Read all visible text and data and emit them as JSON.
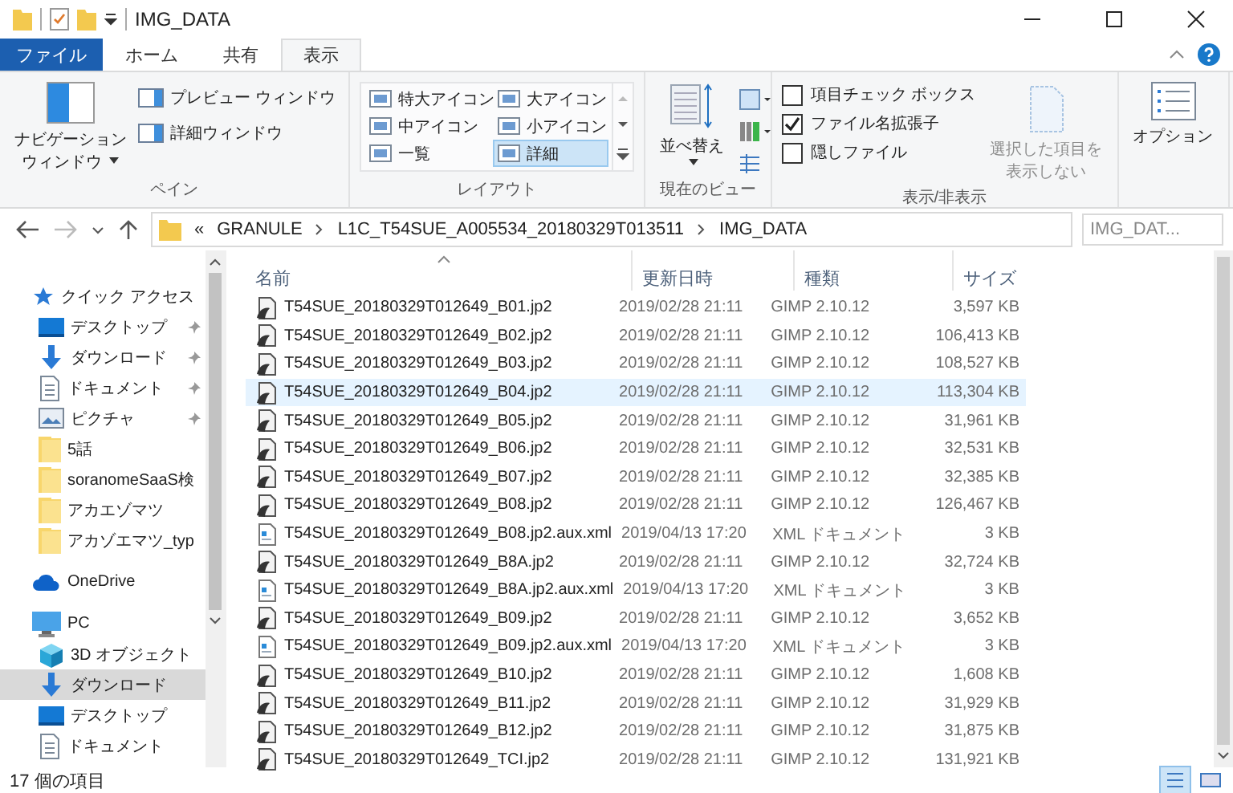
{
  "title_bar": {
    "title": "IMG_DATA"
  },
  "ribbon_tabs": [
    {
      "label": "ファイル",
      "kind": "file",
      "selected": false
    },
    {
      "label": "ホーム",
      "kind": "tab",
      "selected": false
    },
    {
      "label": "共有",
      "kind": "tab",
      "selected": false
    },
    {
      "label": "表示",
      "kind": "tab",
      "selected": true
    }
  ],
  "panes": {
    "caption": "ペイン",
    "nav_pane": [
      "ナビゲーション",
      "ウィンドウ"
    ],
    "preview_pane": "プレビュー ウィンドウ",
    "details_pane": "詳細ウィンドウ"
  },
  "layout": {
    "caption": "レイアウト",
    "options": [
      {
        "label": "特大アイコン",
        "selected": false
      },
      {
        "label": "大アイコン",
        "selected": false
      },
      {
        "label": "中アイコン",
        "selected": false
      },
      {
        "label": "小アイコン",
        "selected": false
      },
      {
        "label": "一覧",
        "selected": false
      },
      {
        "label": "詳細",
        "selected": true
      }
    ]
  },
  "current_view": {
    "caption": "現在のビュー",
    "sort_label": "並べ替え"
  },
  "show_hide": {
    "caption": "表示/非表示",
    "checkboxes": [
      {
        "label": "項目チェック ボックス",
        "checked": false
      },
      {
        "label": "ファイル名拡張子",
        "checked": true
      },
      {
        "label": "隠しファイル",
        "checked": false
      }
    ],
    "hide_selected": {
      "lines": [
        "選択した項目を",
        "表示しない"
      ],
      "disabled": true
    }
  },
  "options": {
    "label": "オプション"
  },
  "nav_buttons": [
    {
      "kind": "back",
      "disabled": false
    },
    {
      "kind": "forward",
      "disabled": true
    },
    {
      "kind": "recent",
      "disabled": false
    },
    {
      "kind": "up",
      "disabled": false
    }
  ],
  "breadcrumb": {
    "overflow": "«",
    "parts": [
      "GRANULE",
      "L1C_T54SUE_A005534_20180329T013511",
      "IMG_DATA"
    ]
  },
  "search": {
    "placeholder": "IMG_DAT..."
  },
  "sidebar": [
    {
      "label": "クイック アクセス",
      "kind": "star",
      "selected": false,
      "children": [
        {
          "label": "デスクトップ",
          "kind": "desktop",
          "pinned": true,
          "selected": false
        },
        {
          "label": "ダウンロード",
          "kind": "download",
          "pinned": true,
          "selected": false
        },
        {
          "label": "ドキュメント",
          "kind": "documents",
          "pinned": true,
          "selected": false
        },
        {
          "label": "ピクチャ",
          "kind": "pictures",
          "pinned": true,
          "selected": false
        },
        {
          "label": "5話",
          "kind": "folder",
          "pinned": false,
          "selected": false
        },
        {
          "label": "soranomeSaaS検",
          "kind": "folder",
          "pinned": false,
          "selected": false
        },
        {
          "label": "アカエゾマツ",
          "kind": "folder",
          "pinned": false,
          "selected": false
        },
        {
          "label": "アカゾエマツ_typ",
          "kind": "folder",
          "pinned": false,
          "selected": false
        }
      ]
    },
    {
      "label": "OneDrive",
      "kind": "cloud",
      "selected": false
    },
    {
      "label": "PC",
      "kind": "pc",
      "selected": false,
      "children": [
        {
          "label": "3D オブジェクト",
          "kind": "cube",
          "pinned": false,
          "selected": false
        },
        {
          "label": "ダウンロード",
          "kind": "download",
          "pinned": false,
          "selected": true
        },
        {
          "label": "デスクトップ",
          "kind": "desktop",
          "pinned": false,
          "selected": false
        },
        {
          "label": "ドキュメント",
          "kind": "documents",
          "pinned": false,
          "selected": false
        }
      ]
    }
  ],
  "columns": [
    {
      "label": "名前",
      "sorted": true
    },
    {
      "label": "更新日時",
      "sorted": false
    },
    {
      "label": "種類",
      "sorted": false
    },
    {
      "label": "サイズ",
      "sorted": false
    }
  ],
  "files": [
    {
      "name": "T54SUE_20180329T012649_B01.jp2",
      "date": "2019/02/28 21:11",
      "type": "GIMP 2.10.12",
      "size": "3,597 KB",
      "kind": "image",
      "selected": false
    },
    {
      "name": "T54SUE_20180329T012649_B02.jp2",
      "date": "2019/02/28 21:11",
      "type": "GIMP 2.10.12",
      "size": "106,413 KB",
      "kind": "image",
      "selected": false
    },
    {
      "name": "T54SUE_20180329T012649_B03.jp2",
      "date": "2019/02/28 21:11",
      "type": "GIMP 2.10.12",
      "size": "108,527 KB",
      "kind": "image",
      "selected": false
    },
    {
      "name": "T54SUE_20180329T012649_B04.jp2",
      "date": "2019/02/28 21:11",
      "type": "GIMP 2.10.12",
      "size": "113,304 KB",
      "kind": "image",
      "selected": true
    },
    {
      "name": "T54SUE_20180329T012649_B05.jp2",
      "date": "2019/02/28 21:11",
      "type": "GIMP 2.10.12",
      "size": "31,961 KB",
      "kind": "image",
      "selected": false
    },
    {
      "name": "T54SUE_20180329T012649_B06.jp2",
      "date": "2019/02/28 21:11",
      "type": "GIMP 2.10.12",
      "size": "32,531 KB",
      "kind": "image",
      "selected": false
    },
    {
      "name": "T54SUE_20180329T012649_B07.jp2",
      "date": "2019/02/28 21:11",
      "type": "GIMP 2.10.12",
      "size": "32,385 KB",
      "kind": "image",
      "selected": false
    },
    {
      "name": "T54SUE_20180329T012649_B08.jp2",
      "date": "2019/02/28 21:11",
      "type": "GIMP 2.10.12",
      "size": "126,467 KB",
      "kind": "image",
      "selected": false
    },
    {
      "name": "T54SUE_20180329T012649_B08.jp2.aux.xml",
      "date": "2019/04/13 17:20",
      "type": "XML ドキュメント",
      "size": "3 KB",
      "kind": "xml",
      "selected": false
    },
    {
      "name": "T54SUE_20180329T012649_B8A.jp2",
      "date": "2019/02/28 21:11",
      "type": "GIMP 2.10.12",
      "size": "32,724 KB",
      "kind": "image",
      "selected": false
    },
    {
      "name": "T54SUE_20180329T012649_B8A.jp2.aux.xml",
      "date": "2019/04/13 17:20",
      "type": "XML ドキュメント",
      "size": "3 KB",
      "kind": "xml",
      "selected": false
    },
    {
      "name": "T54SUE_20180329T012649_B09.jp2",
      "date": "2019/02/28 21:11",
      "type": "GIMP 2.10.12",
      "size": "3,652 KB",
      "kind": "image",
      "selected": false
    },
    {
      "name": "T54SUE_20180329T012649_B09.jp2.aux.xml",
      "date": "2019/04/13 17:20",
      "type": "XML ドキュメント",
      "size": "3 KB",
      "kind": "xml",
      "selected": false
    },
    {
      "name": "T54SUE_20180329T012649_B10.jp2",
      "date": "2019/02/28 21:11",
      "type": "GIMP 2.10.12",
      "size": "1,608 KB",
      "kind": "image",
      "selected": false
    },
    {
      "name": "T54SUE_20180329T012649_B11.jp2",
      "date": "2019/02/28 21:11",
      "type": "GIMP 2.10.12",
      "size": "31,929 KB",
      "kind": "image",
      "selected": false
    },
    {
      "name": "T54SUE_20180329T012649_B12.jp2",
      "date": "2019/02/28 21:11",
      "type": "GIMP 2.10.12",
      "size": "31,875 KB",
      "kind": "image",
      "selected": false
    },
    {
      "name": "T54SUE_20180329T012649_TCI.jp2",
      "date": "2019/02/28 21:11",
      "type": "GIMP 2.10.12",
      "size": "131,921 KB",
      "kind": "image",
      "selected": false
    }
  ],
  "status_bar": {
    "count": "17 個の項目",
    "views": [
      {
        "kind": "details",
        "selected": true
      },
      {
        "kind": "tiles",
        "selected": false
      }
    ]
  }
}
